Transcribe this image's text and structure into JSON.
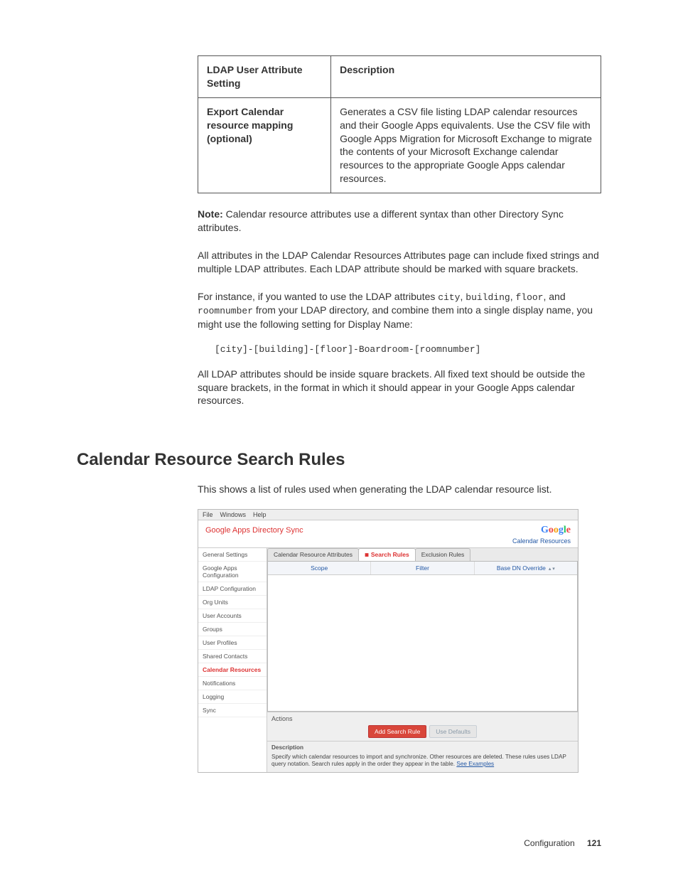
{
  "table": {
    "hdr_setting": "LDAP User Attribute Setting",
    "hdr_desc": "Description",
    "row_setting": "Export Calendar resource mapping (optional)",
    "row_desc": "Generates a CSV file listing LDAP calendar resources and their Google Apps equivalents. Use the CSV file with Google Apps Migration for Microsoft Exchange to migrate the contents of your Microsoft Exchange calendar resources to the appropriate Google Apps calendar resources."
  },
  "note_label": "Note:",
  "note_body": " Calendar resource attributes use a different syntax than other Directory Sync attributes.",
  "p_attr": "All attributes in the LDAP Calendar Resources Attributes page can include fixed strings and multiple LDAP attributes. Each LDAP attribute should be marked with square brackets.",
  "p_instance_a": "For instance, if you wanted to use the LDAP attributes ",
  "code1": "city",
  "code2": "building",
  "code3": "floor",
  "p_instance_b": ", and ",
  "code4": "roomnumber",
  "p_instance_c": " from your LDAP directory, and combine them into a single display name, you might use the following setting for Display Name:",
  "codeblock": "[city]-[building]-[floor]-Boardroom-[roomnumber]",
  "p_outside": "All LDAP attributes should be inside square brackets. All fixed text should be outside the square brackets, in the format in which it should appear in your Google Apps calendar resources.",
  "section_heading": "Calendar Resource Search Rules",
  "p_section_intro": "This shows a list of rules used when generating the LDAP calendar resource list.",
  "shot": {
    "menu_file": "File",
    "menu_windows": "Windows",
    "menu_help": "Help",
    "app_title": "Google Apps Directory Sync",
    "breadcrumb": "Calendar Resources",
    "sidebar": [
      "General Settings",
      "Google Apps Configuration",
      "LDAP Configuration",
      "Org Units",
      "User Accounts",
      "Groups",
      "User Profiles",
      "Shared Contacts",
      "Calendar Resources",
      "Notifications",
      "Logging",
      "Sync"
    ],
    "tab1": "Calendar Resource Attributes",
    "tab2": "Search Rules",
    "tab3": "Exclusion Rules",
    "col_scope": "Scope",
    "col_filter": "Filter",
    "col_base": "Base DN Override",
    "actions_label": "Actions",
    "btn_add": "Add Search Rule",
    "btn_defaults": "Use Defaults",
    "desc_label": "Description",
    "desc_body": "Specify which calendar resources to import and synchronize. Other resources are deleted. These rules uses LDAP query notation. Search rules apply in the order they appear in the table. ",
    "desc_link": "See Examples"
  },
  "footer_label": "Configuration",
  "footer_page": "121"
}
